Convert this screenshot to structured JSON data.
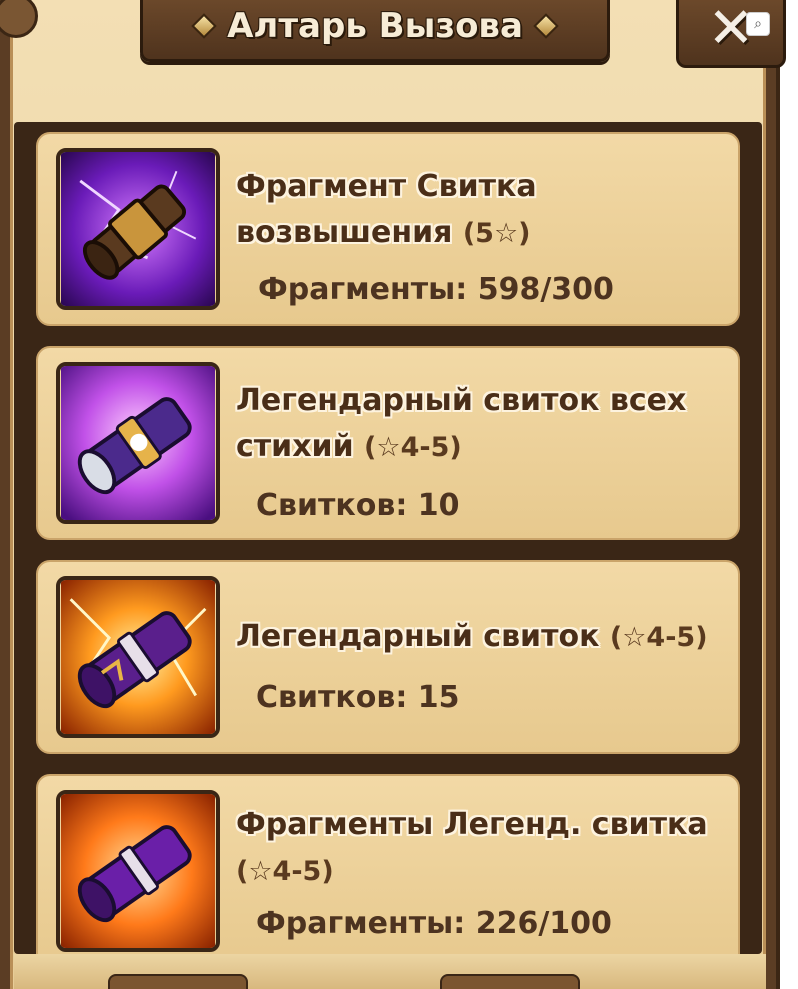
{
  "header": {
    "title": "Алтарь Вызова",
    "close_label": "✕",
    "scan_icon": "⌕"
  },
  "items": [
    {
      "name_line1": "Фрагмент Свитка",
      "name_line2": "возвышения",
      "tier": "(5☆)",
      "count": "Фрагменты: 598/300",
      "icon": "ascension-scroll-fragment-icon",
      "accent": "#7b2fd6"
    },
    {
      "name_line1": "Легендарный свиток всех",
      "name_line2": "стихий",
      "tier": "(☆4-5)",
      "count": "Свитков: 10",
      "icon": "legendary-all-elements-scroll-icon",
      "accent": "#b04ee0"
    },
    {
      "name_line1": "Легендарный свиток",
      "name_line2": "",
      "tier": "(☆4-5)",
      "count": "Свитков: 15",
      "icon": "legendary-scroll-icon",
      "accent": "#f08a1c"
    },
    {
      "name_line1": "Фрагменты Легенд. свитка",
      "name_line2": "",
      "tier": "(☆4-5)",
      "count": "Фрагменты: 226/100",
      "icon": "legendary-scroll-fragments-icon",
      "accent": "#f07a1c"
    }
  ]
}
